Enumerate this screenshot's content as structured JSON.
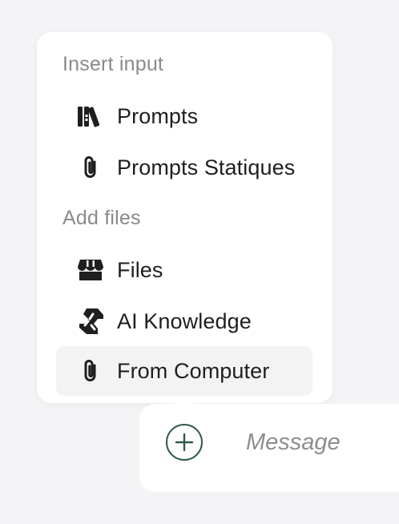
{
  "menu": {
    "sections": [
      {
        "label": "Insert input",
        "items": [
          {
            "label": "Prompts",
            "icon": "library-books-icon"
          },
          {
            "label": "Prompts Statiques",
            "icon": "paperclip-icon"
          }
        ]
      },
      {
        "label": "Add files",
        "items": [
          {
            "label": "Files",
            "icon": "storefront-icon"
          },
          {
            "label": "AI Knowledge",
            "icon": "puzzle-knowledge-icon"
          },
          {
            "label": "From Computer",
            "icon": "paperclip-icon",
            "highlighted": true
          }
        ]
      }
    ]
  },
  "composer": {
    "placeholder": "Message",
    "add_button_icon": "plus-circle-icon",
    "accent_color": "#2f5a4a"
  }
}
